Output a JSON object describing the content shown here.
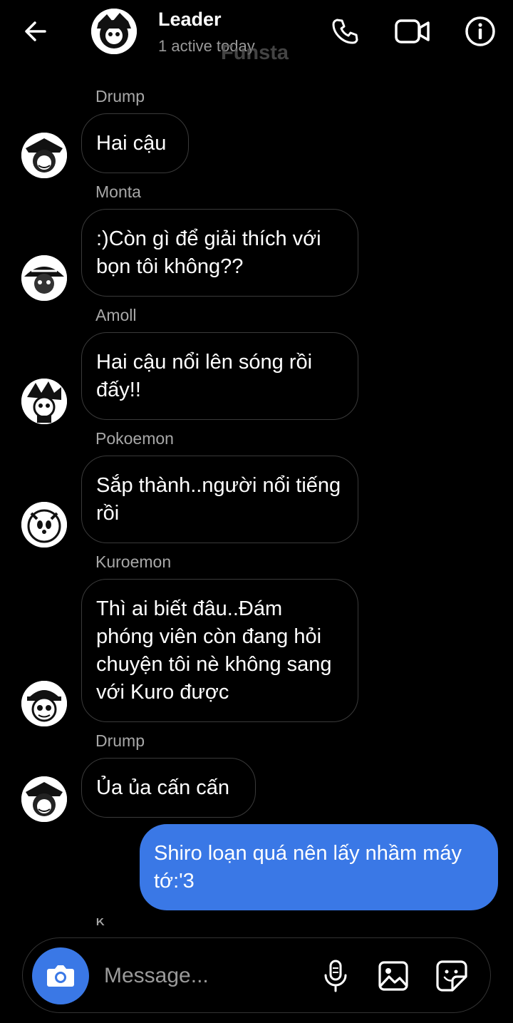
{
  "header": {
    "title": "Leader",
    "subtitle": "1 active today",
    "watermark": "Funsta",
    "icons": [
      "back-arrow-icon",
      "phone-icon",
      "video-camera-icon",
      "info-icon"
    ]
  },
  "messages": [
    {
      "sender": "Drump",
      "text": "Hai cậu"
    },
    {
      "sender": "Monta",
      "text": ":)Còn gì để giải thích với bọn tôi không??"
    },
    {
      "sender": "Amoll",
      "text": "Hai cậu nổi lên sóng rồi đấy!!"
    },
    {
      "sender": "Pokoemon",
      "text": "Sắp thành..người nổi tiếng rồi"
    },
    {
      "sender": "Kuroemon",
      "text": "Thì ai biết đâu..Đám phóng viên còn đang hỏi chuyện tôi nè không sang với Kuro được"
    },
    {
      "sender": "Drump",
      "text": "Ủa ủa cấn cấn"
    }
  ],
  "outgoing": {
    "text": "Shiro loạn quá nên lấy nhầm máy tớ:'3"
  },
  "next_sender_peek": "K",
  "composer": {
    "placeholder": "Message...",
    "icons": [
      "camera-icon",
      "microphone-icon",
      "gallery-icon",
      "sticker-icon"
    ]
  },
  "colors": {
    "background": "#000000",
    "accent": "#3a78e6",
    "muted": "#a8a8a8",
    "bubble_border": "#3a3a3a"
  }
}
